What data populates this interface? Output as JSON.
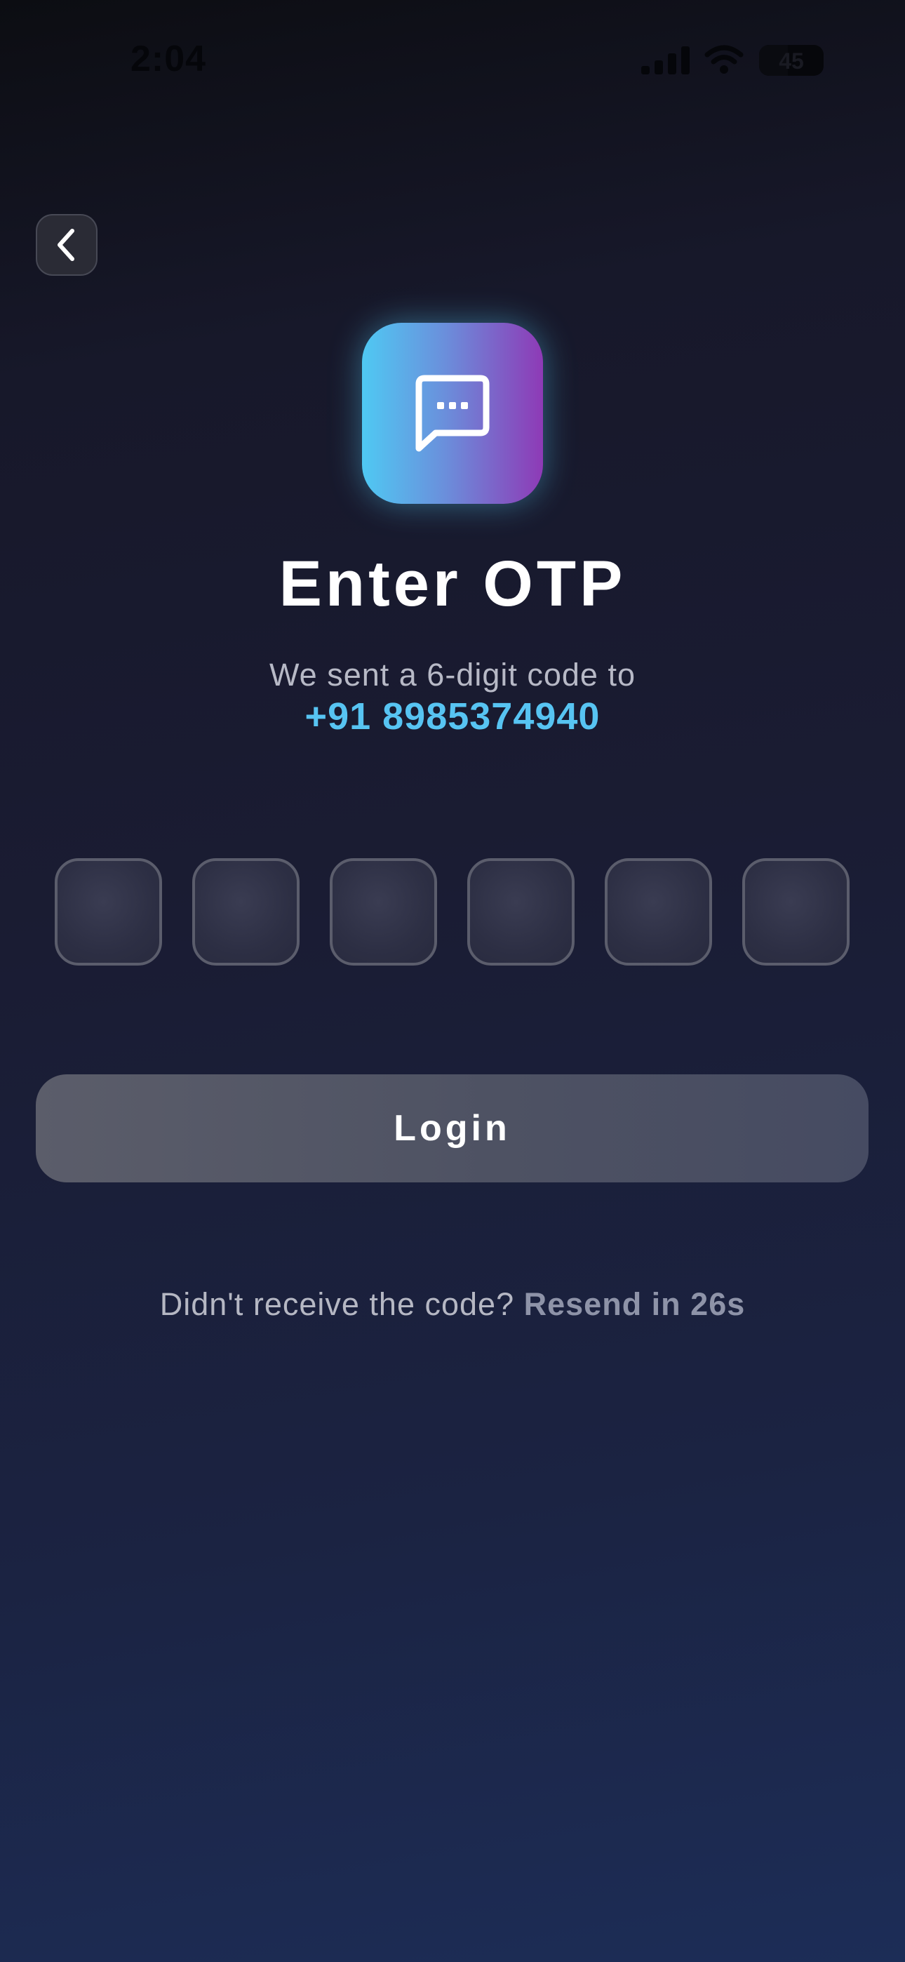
{
  "status_bar": {
    "time": "2:04",
    "battery_level": "45",
    "battery_fraction": 0.45
  },
  "header": {
    "back_icon": "chevron-left-icon"
  },
  "app_icon": {
    "icon": "message-dots-icon",
    "gradient_start": "#4fc9f3",
    "gradient_end": "#8e3ab6"
  },
  "title": "Enter OTP",
  "subtitle": "We sent a 6-digit code to",
  "phone_number": "+91 8985374940",
  "otp": {
    "digits": [
      "",
      "",
      "",
      "",
      "",
      ""
    ]
  },
  "login_label": "Login",
  "resend": {
    "prompt": "Didn't receive the code?",
    "link": "Resend in 26s"
  },
  "colors": {
    "accent": "#57c4f2",
    "button": "#4e5263",
    "background_top": "#0c0d12",
    "background_bottom": "#1c2d57"
  }
}
